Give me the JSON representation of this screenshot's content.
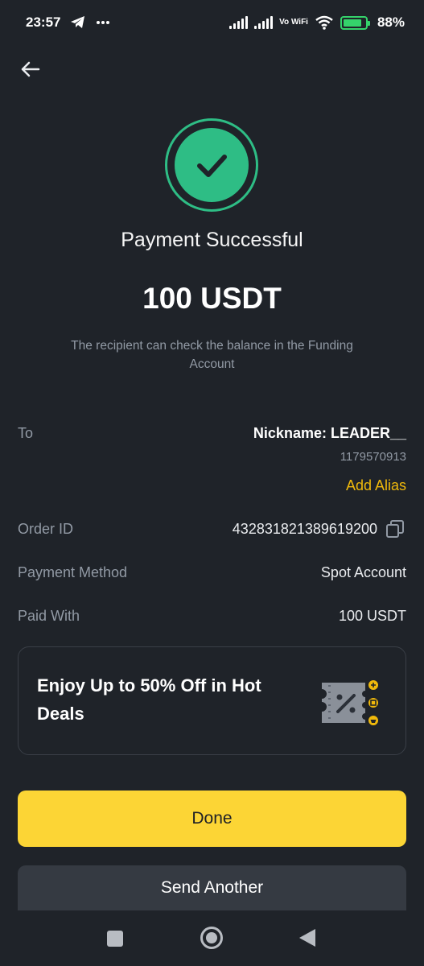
{
  "status_bar": {
    "time": "23:57",
    "network_label": "Vo WiFi",
    "battery_percent": "88%"
  },
  "icons": {
    "back": "arrow-left-icon",
    "success": "checkmark-circle-icon",
    "copy": "copy-icon",
    "promo": "discount-ticket-icon",
    "telegram": "telegram-icon",
    "more": "more-dots-icon",
    "signal": "signal-icon",
    "wifi": "wifi-icon",
    "battery": "battery-charging-icon",
    "nav_recent": "square-icon",
    "nav_home": "circle-icon",
    "nav_back": "triangle-back-icon"
  },
  "header": {
    "title": "Payment Successful",
    "amount": "100 USDT",
    "note": "The recipient can check the balance in the Funding Account"
  },
  "details": {
    "to": {
      "label": "To",
      "nickname": "Nickname: LEADER__",
      "uid": "1179570913",
      "add_alias": "Add Alias"
    },
    "order_id": {
      "label": "Order ID",
      "value": "432831821389619200"
    },
    "payment_method": {
      "label": "Payment Method",
      "value": "Spot Account"
    },
    "paid_with": {
      "label": "Paid With",
      "value": "100 USDT"
    }
  },
  "promo": {
    "text": "Enjoy Up to 50% Off in Hot Deals"
  },
  "actions": {
    "done_label": "Done",
    "send_another_label": "Send Another"
  },
  "colors": {
    "background": "#1f2329",
    "success_green": "#2ebd85",
    "accent_yellow": "#fcd535",
    "alias_yellow": "#f0b90b",
    "muted_text": "#929aa5",
    "secondary_button": "#353a42"
  }
}
